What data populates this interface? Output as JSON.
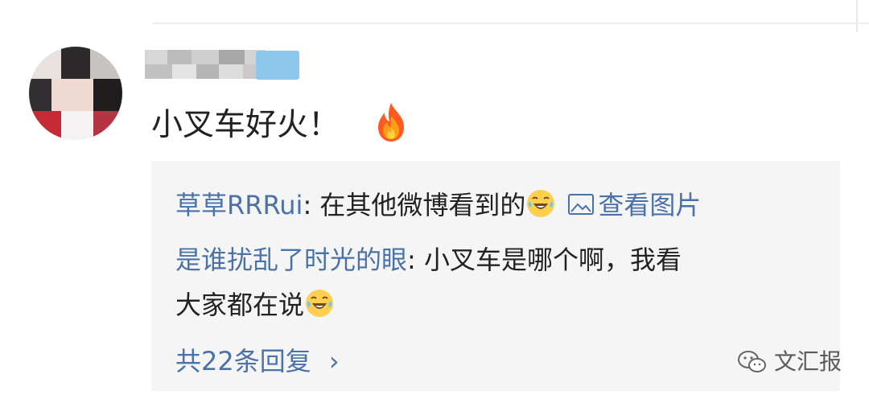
{
  "comment": {
    "user_name": "",
    "badge_label": "",
    "text": "小叉车好火！",
    "fire_icon": "fire-icon"
  },
  "replies": [
    {
      "user": "草草RRRui",
      "text": ": 在其他微博看到的",
      "emoji": "laughing-crying-emoji",
      "link_label": "查看图片"
    },
    {
      "user": "是谁扰乱了时光的眼",
      "text_line_1": ": 小叉车是哪个啊，我看",
      "text_line_2": "大家都在说",
      "emoji": "laughing-crying-emoji"
    }
  ],
  "more_replies_label": "共22条回复",
  "more_replies_chevron": "›",
  "watermark": {
    "text": "文汇报",
    "logo_icon": "wechat-icon"
  },
  "colors": {
    "link_blue": "#4a72a8",
    "reply_bg": "#f5f5f5",
    "text_dark": "#222222",
    "emoji_yellow": "#ffd04d",
    "badge_blue": "#8ec7ee"
  }
}
